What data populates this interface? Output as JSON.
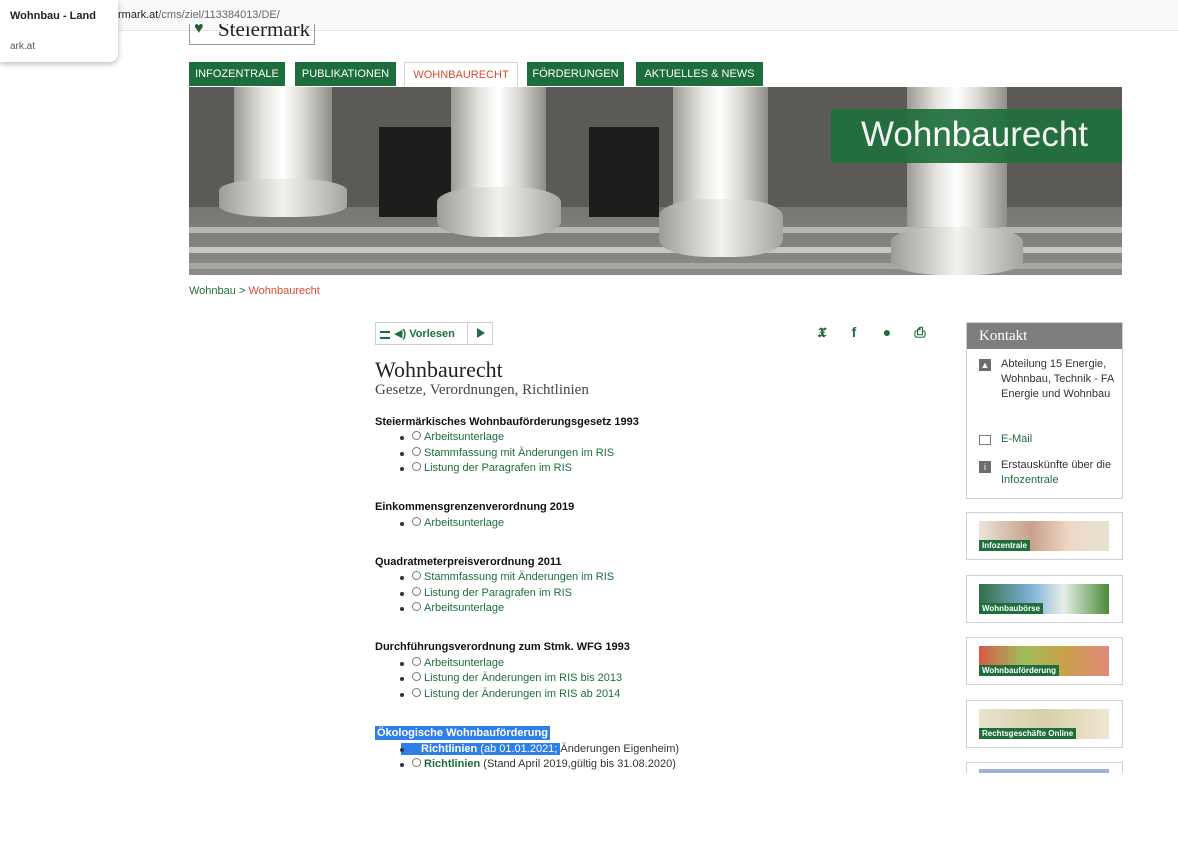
{
  "browser": {
    "url_host": "rmark.at",
    "url_path": "/cms/ziel/113384013/DE/",
    "tab_title": "Wohnbau - Land",
    "tab_domain": "ark.at"
  },
  "header": {
    "logo_text": "Steiermark",
    "nav": [
      {
        "label": "INFOZENTRALE"
      },
      {
        "label": "PUBLIKATIONEN"
      },
      {
        "label": "WOHNBAURECHT"
      },
      {
        "label": "FÖRDERUNGEN"
      },
      {
        "label": "AKTUELLES & NEWS"
      }
    ],
    "hero_title": "Wohnbaurecht"
  },
  "breadcrumb": {
    "parent": "Wohnbau",
    "separator": ">",
    "current": "Wohnbaurecht"
  },
  "tools": {
    "read_label": "Vorlesen",
    "share_icons": [
      "twitter-icon",
      "facebook-icon",
      "comment-icon",
      "print-icon"
    ]
  },
  "main": {
    "title": "Wohnbaurecht",
    "subtitle": "Gesetze, Verordnungen, Richtlinien",
    "sections": [
      {
        "title": "Steiermärkisches Wohnbauförderungsgesetz 1993",
        "items": [
          {
            "text": "Arbeitsunterlage"
          },
          {
            "text": "Stammfassung mit Änderungen im RIS"
          },
          {
            "text": "Listung der Paragrafen im RIS"
          }
        ]
      },
      {
        "title": "Einkommensgrenzenverordnung 2019",
        "items": [
          {
            "text": "Arbeitsunterlage"
          }
        ]
      },
      {
        "title": "Quadratmeterpreisverordnung 2011",
        "items": [
          {
            "text": "Stammfassung mit Änderungen im RIS"
          },
          {
            "text": "Listung der Paragrafen im RIS"
          },
          {
            "text": "Arbeitsunterlage"
          }
        ]
      },
      {
        "title": "Durchführungsverordnung zum Stmk. WFG 1993",
        "items": [
          {
            "text": "Arbeitsunterlage"
          },
          {
            "text": "Listung der Änderungen im RIS bis 2013"
          },
          {
            "text": "Listung der Änderungen im RIS ab 2014"
          }
        ]
      },
      {
        "title": "Ökologische Wohnbauförderung",
        "items": [
          {
            "link": "Richtlinien",
            "note_highlighted": " (ab 01.01.2021; ",
            "note": "Änderungen Eigenheim)"
          },
          {
            "link": "Richtlinien",
            "note": " (Stand April 2019,gültig bis 31.08.2020)"
          }
        ]
      }
    ]
  },
  "sidebar": {
    "kontakt_title": "Kontakt",
    "department": "Abteilung 15 Energie, Wohnbau, Technik - FA Energie und Wohnbau",
    "email_label": "E-Mail",
    "info_text": "Erstauskünfte über die",
    "info_link": "Infozentrale",
    "tiles": [
      {
        "label": "Infozentrale"
      },
      {
        "label": "Wohnbaubörse"
      },
      {
        "label": "Wohnbauförderung"
      },
      {
        "label": "Rechtsgeschäfte Online"
      }
    ]
  },
  "colors": {
    "brand_green": "#1e6e3d",
    "accent_red": "#d84b30",
    "selection_blue": "#2f7fe8"
  }
}
